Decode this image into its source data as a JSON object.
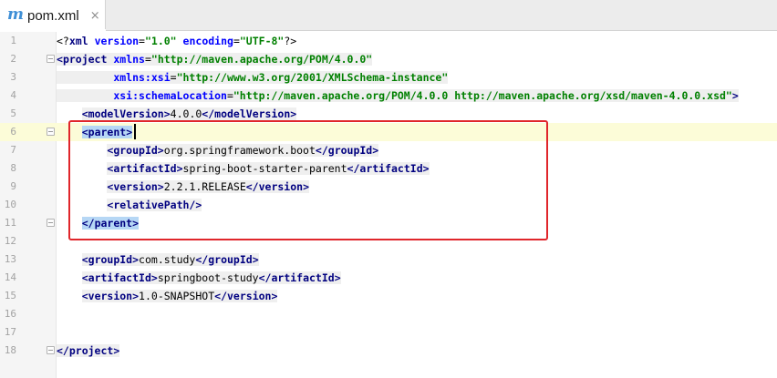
{
  "tab": {
    "icon": "m",
    "title": "pom.xml",
    "close": "×"
  },
  "colors": {
    "tag": "#000080",
    "attribute": "#0000ff",
    "string": "#008000",
    "selection": "#b6d7f5",
    "annotation_box": "#e0262b"
  },
  "line_numbers": [
    "1",
    "2",
    "3",
    "4",
    "5",
    "6",
    "7",
    "8",
    "9",
    "10",
    "11",
    "12",
    "13",
    "14",
    "15",
    "16",
    "17",
    "18"
  ],
  "code": {
    "l1": {
      "p1": "<?",
      "t": "xml",
      "sp1": " ",
      "a1": "version",
      "eq1": "=",
      "s1": "\"1.0\"",
      "sp2": " ",
      "a2": "encoding",
      "eq2": "=",
      "s2": "\"UTF-8\"",
      "p2": "?>"
    },
    "l2": {
      "p1": "<",
      "t": "project",
      "sp1": " ",
      "a1": "xmlns",
      "eq1": "=",
      "s1": "\"http://maven.apache.org/POM/4.0.0\""
    },
    "l3": {
      "indent": "         ",
      "a1": "xmlns:xsi",
      "eq1": "=",
      "s1": "\"http://www.w3.org/2001/XMLSchema-instance\""
    },
    "l4": {
      "indent": "         ",
      "a1": "xsi:schemaLocation",
      "eq1": "=",
      "s1": "\"http://maven.apache.org/POM/4.0.0 http://maven.apache.org/xsd/maven-4.0.0.xsd\"",
      "p2": ">"
    },
    "l5": {
      "indent": "    ",
      "o1": "<",
      "t1": "modelVersion",
      "c1": ">",
      "v": "4.0.0",
      "o2": "</",
      "t2": "modelVersion",
      "c2": ">"
    },
    "l6": {
      "indent": "    ",
      "o1": "<",
      "t1": "parent",
      "c1": ">"
    },
    "l7": {
      "indent": "        ",
      "o1": "<",
      "t1": "groupId",
      "c1": ">",
      "v": "org.springframework.boot",
      "o2": "</",
      "t2": "groupId",
      "c2": ">"
    },
    "l8": {
      "indent": "        ",
      "o1": "<",
      "t1": "artifactId",
      "c1": ">",
      "v": "spring-boot-starter-parent",
      "o2": "</",
      "t2": "artifactId",
      "c2": ">"
    },
    "l9": {
      "indent": "        ",
      "o1": "<",
      "t1": "version",
      "c1": ">",
      "v": "2.2.1.RELEASE",
      "o2": "</",
      "t2": "version",
      "c2": ">"
    },
    "l10": {
      "indent": "        ",
      "o1": "<",
      "t1": "relativePath",
      "c1": "/>"
    },
    "l11": {
      "indent": "    ",
      "o1": "</",
      "t1": "parent",
      "c1": ">"
    },
    "l13": {
      "indent": "    ",
      "o1": "<",
      "t1": "groupId",
      "c1": ">",
      "v": "com.study",
      "o2": "</",
      "t2": "groupId",
      "c2": ">"
    },
    "l14": {
      "indent": "    ",
      "o1": "<",
      "t1": "artifactId",
      "c1": ">",
      "v": "springboot-study",
      "o2": "</",
      "t2": "artifactId",
      "c2": ">"
    },
    "l15": {
      "indent": "    ",
      "o1": "<",
      "t1": "version",
      "c1": ">",
      "v": "1.0-SNAPSHOT",
      "o2": "</",
      "t2": "version",
      "c2": ">"
    },
    "l18": {
      "o1": "</",
      "t1": "project",
      "c1": ">"
    }
  }
}
